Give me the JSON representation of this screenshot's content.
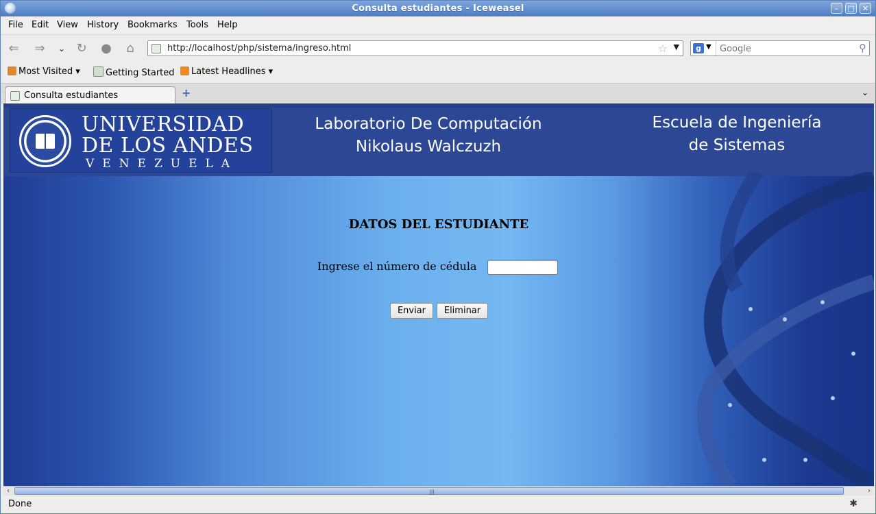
{
  "window": {
    "title": "Consulta estudiantes - Iceweasel"
  },
  "menu": {
    "items": [
      "File",
      "Edit",
      "View",
      "History",
      "Bookmarks",
      "Tools",
      "Help"
    ]
  },
  "nav": {
    "url": "http://localhost/php/sistema/ingreso.html",
    "search_placeholder": "Google"
  },
  "bookmarks": {
    "items": [
      "Most Visited",
      "Getting Started",
      "Latest Headlines"
    ]
  },
  "tabs": [
    {
      "label": "Consulta estudiantes"
    }
  ],
  "banner": {
    "logo_line1": "UNIVERSIDAD",
    "logo_line2": "DE LOS ANDES",
    "logo_line3": "VENEZUELA",
    "lab_line1": "Laboratorio De Computación",
    "lab_line2": "Nikolaus Walczuzh",
    "school_line1": "Escuela de Ingeniería",
    "school_line2": "de Sistemas"
  },
  "form": {
    "title": "DATOS DEL ESTUDIANTE",
    "cedula_label": "Ingrese el número de cédula",
    "cedula_value": "",
    "submit_label": "Enviar",
    "reset_label": "Eliminar"
  },
  "status": {
    "text": "Done"
  },
  "colors": {
    "titlebar": "#4c7cc4",
    "banner": "#2c4794",
    "content_light": "#74b7f2",
    "content_dark": "#1f3c93"
  }
}
